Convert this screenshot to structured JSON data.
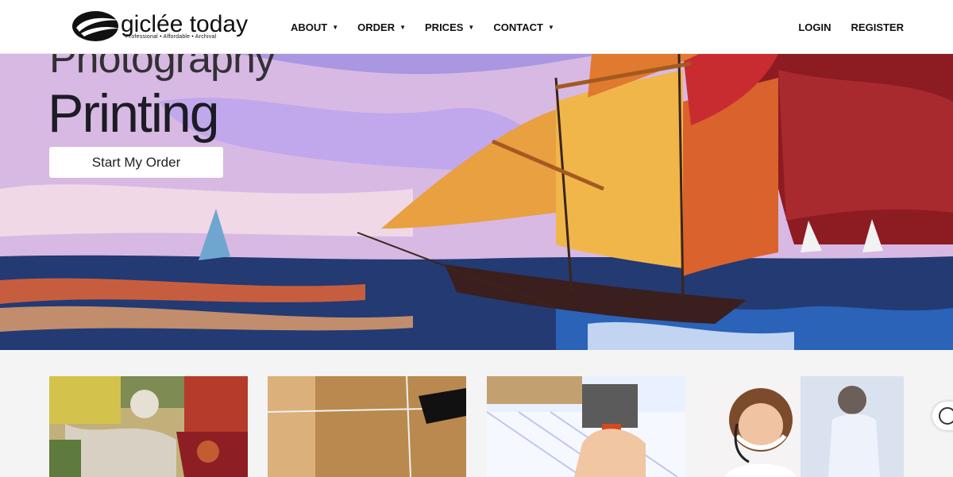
{
  "header": {
    "logo": {
      "name": "giclée today",
      "tagline": "Professional • Affordable • Archival"
    },
    "nav": [
      {
        "label": "ABOUT"
      },
      {
        "label": "ORDER"
      },
      {
        "label": "PRICES"
      },
      {
        "label": "CONTACT"
      }
    ],
    "auth": {
      "login": "LOGIN",
      "register": "REGISTER"
    }
  },
  "hero": {
    "line1": "Photography",
    "line2": "Printing",
    "cta": "Start My Order"
  },
  "colors": {
    "header_bg": "#ffffff",
    "text": "#111111",
    "page_bg": "#f4f4f4"
  },
  "cards": [
    {
      "image": "abstract-painting-texture"
    },
    {
      "image": "kraft-paper-package-with-twine"
    },
    {
      "image": "hammer-and-frame"
    },
    {
      "image": "customer-support-agent-headset"
    }
  ]
}
